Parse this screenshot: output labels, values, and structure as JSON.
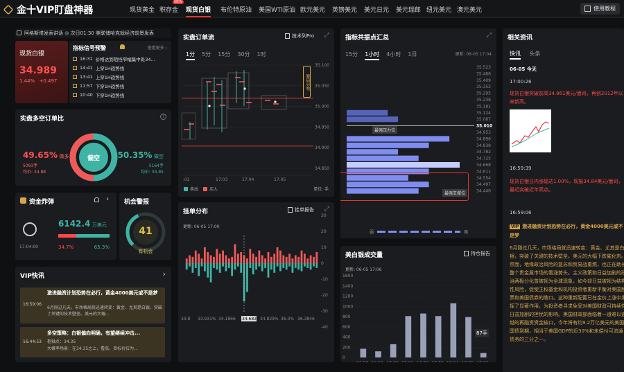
{
  "header": {
    "logo_text": "金十VIP盯盘神器",
    "nav": [
      {
        "label": "现货黄金",
        "active": false
      },
      {
        "label": "积存金",
        "active": false,
        "badge": "NEW"
      },
      {
        "label": "现货白银",
        "active": true
      },
      {
        "label": "布伦特原油",
        "active": false
      },
      {
        "label": "美国WTI原油",
        "active": false
      },
      {
        "label": "欧元美元",
        "active": false
      },
      {
        "label": "英镑美元",
        "active": false
      },
      {
        "label": "美元日元",
        "active": false
      },
      {
        "label": "美元瑞郎",
        "active": false
      },
      {
        "label": "纽元美元",
        "active": false
      },
      {
        "label": "澳元美元",
        "active": false
      }
    ],
    "tutorial_label": "使用教程"
  },
  "ticker": {
    "text": "阿格斯塔发表讲话 ◎ 次日01:30 美联储哈克就经济前景发表"
  },
  "quote": {
    "name": "现货白银",
    "price": "34.989",
    "change_pct": "1.44%",
    "change": "+0.497"
  },
  "signals": {
    "title": "指标信号预警",
    "more": "查看更多 ›",
    "items": [
      {
        "time": "16:31",
        "text": "价格达到阻挡窄幅集中处34..."
      },
      {
        "time": "14:41",
        "text": "上穿1H趋势线"
      },
      {
        "time": "13:41",
        "text": "上穿1H趋势线"
      },
      {
        "time": "11:57",
        "text": "下穿1H趋势线"
      },
      {
        "time": "10:40",
        "text": "下穿1H趋势线"
      }
    ]
  },
  "long_short": {
    "title": "实盘多空订单比",
    "long_pct": "49.65%",
    "long_label": "做多",
    "long_count": "5093手",
    "long_avg": "均价: 34.88",
    "short_pct": "50.35%",
    "short_label": "做空",
    "short_count": "5164手",
    "short_avg": "均价: 34.85",
    "center_label": "偏空",
    "long_fraction": 0.4965
  },
  "bomb": {
    "title": "资金炸弹",
    "amount": "6142.4",
    "unit": "万美元",
    "time": "17:04:00",
    "red_pct": "34.7%",
    "green_pct": "65.3%",
    "red_fraction": 0.347
  },
  "alert": {
    "title": "机会警报",
    "score": "41",
    "label": "有机会",
    "score_fraction": 0.41
  },
  "vip": {
    "title": "VIP快讯",
    "items": [
      {
        "time": "16:59:06",
        "headline": "激进融资计划恐势在必行，黄金4000美元或不是梦",
        "body": "6月刚过几天，市场格局就迅速转变：黄金、尤其是白银，突破了关键的技术壁垒。美元的大幅..."
      },
      {
        "time": "16:44:53",
        "headline": "多空策略：白银偏向明确，有望继续冲击...",
        "body": "枢轴点：34.35",
        "body2": "大概率场景：在34.35之上，看涨，目标价位为..."
      }
    ]
  },
  "orderflow": {
    "title": "实盘订单流",
    "report": "技术列Pro",
    "tabs": [
      "1分",
      "5分",
      "15分",
      "30分",
      "1时"
    ],
    "active_tab": 0,
    "prices": [
      "35.100",
      "35.050",
      "35.000",
      "34.950",
      "34.900",
      "34.850"
    ],
    "times": [
      ":02",
      "17:03",
      "17:04",
      "17:05"
    ],
    "side_label": "筹码分布",
    "legend_sell": "卖出",
    "legend_buy": "买入",
    "unit": "单位: 手"
  },
  "order_dist": {
    "title": "挂单分布",
    "report": "挂单报告",
    "updated": "更新: 06-05 17:00",
    "x_labels": [
      "33.8",
      "33.931%",
      "34.1866",
      "34.683",
      "34.829%",
      "36.0%",
      "36.3846"
    ],
    "y_labels": [
      "30",
      "20",
      "10",
      "0",
      "-10",
      "-20",
      "-30",
      "-40"
    ]
  },
  "resonance": {
    "title": "指标共振点汇总",
    "tabs": [
      "15分",
      "1小时",
      "4小时",
      "1日"
    ],
    "active_tab": 1,
    "updated": "更新: 06-05 17:04",
    "prices": [
      "35.523",
      "35.466",
      "35.409",
      "35.352",
      "35.295",
      "35.238",
      "35.181",
      "35.124",
      "35.067",
      "35.010",
      "34.953",
      "34.896",
      "34.839",
      "34.782",
      "34.725",
      "34.668",
      "34.611",
      "34.554",
      "34.497",
      "34.440"
    ],
    "current_price": "35.010",
    "resistance_label": "最强压力位",
    "support_label": "最强支撑位",
    "bar_values": [
      0,
      0,
      0,
      0,
      0,
      0,
      0,
      4,
      5,
      0,
      0,
      10,
      8,
      5,
      7,
      11,
      8,
      6,
      8,
      7
    ],
    "legend_left": "弱",
    "legend_right": "强"
  },
  "volume": {
    "title": "美白银成交量",
    "report": "持仓报告",
    "updated": "更新: 06-05 17:06",
    "y_labels": [
      "1600",
      "1400",
      "1200",
      "1000",
      "800",
      "600",
      "400",
      "200",
      "0"
    ],
    "categories": [
      "16:58",
      "16:59",
      "17:00",
      "17:01",
      "17:02",
      "17:03",
      "17:04",
      "17:05",
      "17:06"
    ],
    "values": [
      170,
      120,
      260,
      810,
      860,
      810,
      1060,
      790,
      87
    ],
    "last_label": "87手"
  },
  "news": {
    "title": "相关资讯",
    "tabs": [
      "快讯",
      "头条"
    ],
    "date": "06-05 今天",
    "items": [
      {
        "time": "17:00:26",
        "text": "现货白银突破前高34.861美元/盎司，再创2012年以来新高。"
      },
      {
        "time": "16:59:39",
        "text": "现货白银日内涨幅达1.00%，现报34.84美元/盎司，最近突破近年高点。"
      },
      {
        "time": "16:59:06",
        "badge": "VIP",
        "headline": "激进融资计划恐势在必行，黄金4000美元或不是梦",
        "body": "6月刚过几天，市场格局就迅速转变：黄金、尤其是白银，突破了关键的技术壁垒。美元的大幅下跌催化剂。然而，地缘政治风险的复苏和贸易战重燃，也正在助长整个贵金属市场的看涨势头。主义政策和日益加剧的政治两极分化曾被视为全球现象，如今却日益被视为结构性风险，促使主权基金和机构投资者重新平衡对美国股票和美国债券的敞口。这种重新配置已在金价上涨中发挥了显著作用，为投资者寻求免受对美国财政可持续性日益加剧的担忧的影响。美国财政部面临着一道难以逾越的再融资资金缺口，今年将有约9.2万亿美元的美国国债到期，相当于美国GDP的近30%和未偿付可流通债务的三分之一。"
      }
    ]
  },
  "colors": {
    "red": "#ff4a4a",
    "green": "#3fb4a5",
    "gold": "#d7a64b",
    "panel": "#1b1c1f",
    "bar_blue": "#7f8df0"
  }
}
